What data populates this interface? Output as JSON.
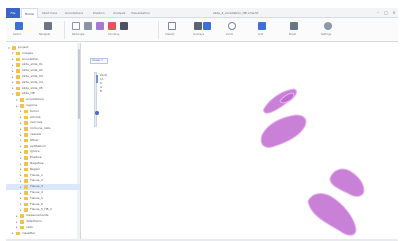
{
  "app": {
    "file_tab": "File",
    "tabs": [
      "Home",
      "Start here",
      "Annotations",
      "Position",
      "Analysis",
      "Visualization"
    ],
    "active_tab": "Home",
    "document_title": "slide_4_annotation_HE.ome.tif"
  },
  "ribbon": {
    "groups": [
      {
        "icon": "pointer-icon",
        "label": "Select"
      },
      {
        "icon": "pan-icon",
        "label": "Navigate"
      },
      {
        "icon": "rectangle-icon",
        "label": "Rectangle"
      },
      {
        "icon": "magic-wand-icon",
        "label": "Wand"
      },
      {
        "icon": "brush-icon",
        "label": "Brush"
      },
      {
        "icon": "count-icon",
        "label": "Counting"
      },
      {
        "icon": "overlay-icon",
        "label": "Overlays"
      },
      {
        "icon": "pixel-classifier-icon",
        "label": "Classify"
      },
      {
        "icon": "zoom-icon",
        "label": "Zoom"
      },
      {
        "icon": "grid-icon",
        "label": "Grid"
      },
      {
        "icon": "settings-icon",
        "label": "Settings"
      }
    ]
  },
  "tree": {
    "rows": [
      {
        "label": "project",
        "level": 0,
        "expanded": true
      },
      {
        "label": "images",
        "level": 1,
        "expanded": true
      },
      {
        "label": "Annotation",
        "level": 1,
        "expanded": false
      },
      {
        "label": "slide_slide_01",
        "level": 1,
        "expanded": false
      },
      {
        "label": "slide_slide_02",
        "level": 1,
        "expanded": false
      },
      {
        "label": "slide_slide_03",
        "level": 1,
        "expanded": false
      },
      {
        "label": "slide_slide_04",
        "level": 1,
        "expanded": false
      },
      {
        "label": "slide_slide_05",
        "level": 1,
        "expanded": false
      },
      {
        "label": "slide_HE",
        "level": 1,
        "expanded": true
      },
      {
        "label": "annotations",
        "level": 2,
        "expanded": true
      },
      {
        "label": "regions",
        "level": 2,
        "expanded": false
      },
      {
        "label": "tumor",
        "level": 3,
        "expanded": false
      },
      {
        "label": "stroma",
        "level": 3,
        "expanded": false
      },
      {
        "label": "necrosis",
        "level": 3,
        "expanded": false
      },
      {
        "label": "immune_cells",
        "level": 3,
        "expanded": false
      },
      {
        "label": "vessels",
        "level": 3,
        "expanded": false
      },
      {
        "label": "Other",
        "level": 3,
        "expanded": false
      },
      {
        "label": "epithelium",
        "level": 3,
        "expanded": false
      },
      {
        "label": "Ignore",
        "level": 3,
        "expanded": false
      },
      {
        "label": "Positive",
        "level": 3,
        "expanded": false
      },
      {
        "label": "Negative",
        "level": 3,
        "expanded": false
      },
      {
        "label": "Region",
        "level": 3,
        "expanded": false
      },
      {
        "label": "Tissue_1",
        "level": 3,
        "expanded": false
      },
      {
        "label": "Tissue_2",
        "level": 3,
        "expanded": false
      },
      {
        "label": "Tissue_3",
        "level": 3,
        "expanded": false
      },
      {
        "label": "Tissue_4",
        "level": 3,
        "expanded": false
      },
      {
        "label": "Tissue_5",
        "level": 3,
        "expanded": false
      },
      {
        "label": "Tissue_6",
        "level": 3,
        "expanded": false
      },
      {
        "label": "Tissue_5_HE_2",
        "level": 3,
        "expanded": false
      },
      {
        "label": "measurements",
        "level": 2,
        "expanded": false
      },
      {
        "label": "detections",
        "level": 2,
        "expanded": false
      },
      {
        "label": "cells",
        "level": 2,
        "expanded": false
      },
      {
        "label": "classifier",
        "level": 1,
        "expanded": false
      }
    ],
    "selected_index": 24
  },
  "viewer": {
    "view_tab": "Viewer 1",
    "mini_labels": [
      "Zoom",
      "Ch",
      "R",
      "G",
      "B"
    ],
    "tissue_color": "#c06ad0",
    "tissue_color_light": "#e7b4ef"
  }
}
